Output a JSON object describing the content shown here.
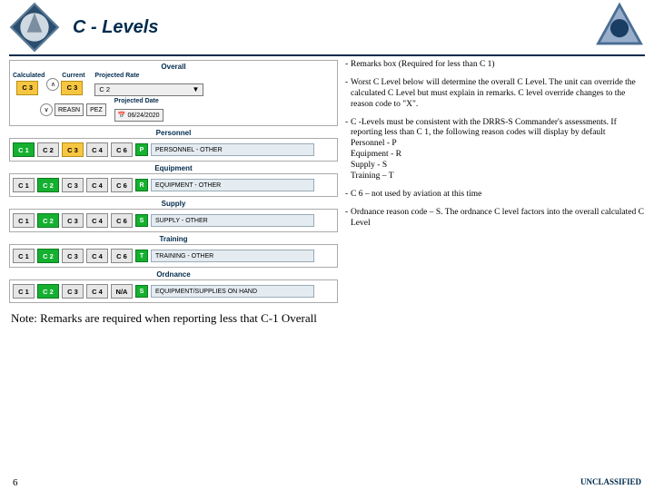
{
  "header": {
    "title": "C - Levels"
  },
  "overall": {
    "title": "Overall",
    "calculated_label": "Calculated",
    "current_label": "Current",
    "calculated": "C 3",
    "current": "C 3",
    "projected_rate_label": "Projected Rate",
    "projected_rate_value": "C 2",
    "reasn_label": "REASN",
    "pez_label": "PEZ",
    "projected_date_label": "Projected Date",
    "projected_date_value": "06/24/2020"
  },
  "sections": {
    "personnel": {
      "title": "Personnel",
      "cells": [
        "C 1",
        "C 2",
        "C 3",
        "C 4",
        "C 6"
      ],
      "code": "P",
      "reason": "PERSONNEL - OTHER",
      "green_index": 0
    },
    "equipment": {
      "title": "Equipment",
      "cells": [
        "C 1",
        "C 2",
        "C 3",
        "C 4",
        "C 6"
      ],
      "code": "R",
      "reason": "EQUIPMENT - OTHER",
      "green_index": 1
    },
    "supply": {
      "title": "Supply",
      "cells": [
        "C 1",
        "C 2",
        "C 3",
        "C 4",
        "C 6"
      ],
      "code": "S",
      "reason": "SUPPLY - OTHER",
      "green_index": 1
    },
    "training": {
      "title": "Training",
      "cells": [
        "C 1",
        "C 2",
        "C 3",
        "C 4",
        "C 6"
      ],
      "code": "T",
      "reason": "TRAINING - OTHER",
      "green_index": 1
    },
    "ordnance": {
      "title": "Ordnance",
      "cells": [
        "C 1",
        "C 2",
        "C 3",
        "C 4",
        "N/A"
      ],
      "code": "S",
      "reason": "EQUIPMENT/SUPPLIES ON HAND",
      "green_index": 1
    }
  },
  "bullets": {
    "b1": "Remarks box (Required for less than C 1)",
    "b2": "Worst C Level below will determine the overall C Level. The unit can override the calculated C Level but must explain in remarks. C level override changes to the reason code to \"X\".",
    "b3_lead": "C -Levels must be consistent with the DRRS-S Commander's assessments. If reporting less than C 1, the following reason codes will display by default",
    "b3_lines": [
      "Personnel - P",
      "Equipment - R",
      "Supply - S",
      "Training – T"
    ],
    "b4": "C 6 – not used by aviation at this time",
    "b5": "Ordnance reason code – S. The ordnance C level factors into the overall calculated C Level"
  },
  "note": "Note: Remarks are required when reporting less that C-1 Overall",
  "footer": {
    "page": "6",
    "classification": "UNCLASSIFIED"
  }
}
